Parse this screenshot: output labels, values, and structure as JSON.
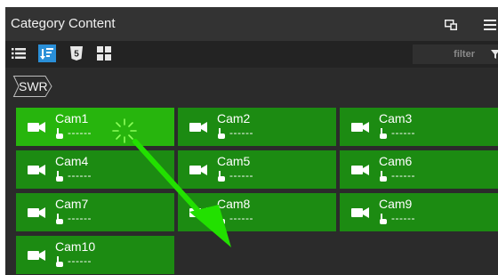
{
  "panel": {
    "title": "Category Content",
    "header_icons": [
      "popout-window-icon",
      "hamburger-menu-icon"
    ]
  },
  "toolbar": {
    "buttons": [
      {
        "name": "list-view",
        "icon": "list-icon",
        "active": false
      },
      {
        "name": "sort-view",
        "icon": "sort-icon",
        "active": true
      },
      {
        "name": "html5-view",
        "icon": "html5-icon",
        "active": false
      },
      {
        "name": "grid-view",
        "icon": "grid-icon",
        "active": false
      }
    ],
    "filter_placeholder": "filter",
    "filter_icon": "funnel-icon"
  },
  "breadcrumb": {
    "label": "SWR"
  },
  "tiles": [
    {
      "name": "Cam1",
      "value": "------",
      "selected": true
    },
    {
      "name": "Cam2",
      "value": "------",
      "selected": false
    },
    {
      "name": "Cam3",
      "value": "------",
      "selected": false
    },
    {
      "name": "Cam4",
      "value": "------",
      "selected": false
    },
    {
      "name": "Cam5",
      "value": "------",
      "selected": false
    },
    {
      "name": "Cam6",
      "value": "------",
      "selected": false
    },
    {
      "name": "Cam7",
      "value": "------",
      "selected": false
    },
    {
      "name": "Cam8",
      "value": "------",
      "selected": false
    },
    {
      "name": "Cam9",
      "value": "------",
      "selected": false
    },
    {
      "name": "Cam10",
      "value": "------",
      "selected": false
    }
  ],
  "colors": {
    "panel_bg": "#2b2b2b",
    "tile_green": "#1c8b12",
    "tile_selected": "#27b50d",
    "toolbar_active": "#2a8fd8",
    "annotation_arrow": "#22e000"
  }
}
